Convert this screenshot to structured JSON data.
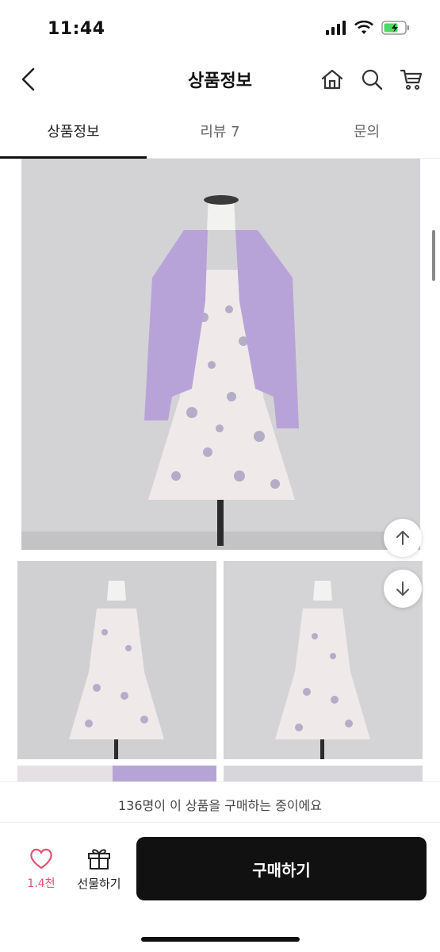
{
  "status_bar": {
    "time": "11:44"
  },
  "nav": {
    "title": "상품정보"
  },
  "tabs": [
    {
      "label": "상품정보",
      "active": true
    },
    {
      "label": "리뷰 7",
      "active": false
    },
    {
      "label": "문의",
      "active": false
    }
  ],
  "notice": {
    "text": "136명이 이 상품을 구매하는 중이에요"
  },
  "bottom_bar": {
    "like_count": "1.4천",
    "gift_label": "선물하기",
    "buy_label": "구매하기"
  },
  "colors": {
    "accent_like": "#e0536f",
    "buy_button": "#111111",
    "battery": "#4cd964"
  },
  "icons": [
    "back-icon",
    "home-icon",
    "search-icon",
    "cart-icon",
    "heart-icon",
    "gift-icon",
    "arrow-up-icon",
    "arrow-down-icon"
  ]
}
